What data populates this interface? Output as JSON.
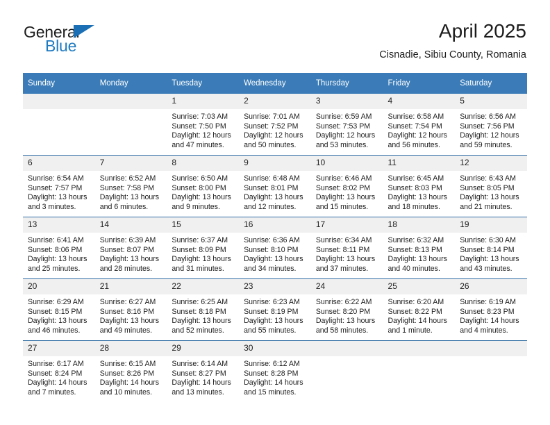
{
  "logo": {
    "word_top": "General",
    "word_bottom": "Blue",
    "accent_color": "#1a6fb5"
  },
  "header": {
    "title": "April 2025",
    "subtitle": "Cisnadie, Sibiu County, Romania"
  },
  "calendar": {
    "header_bg": "#3b7cb8",
    "daynum_bg": "#f0f0f0",
    "row_border": "#2e6ca4",
    "weekday_names": [
      "Sunday",
      "Monday",
      "Tuesday",
      "Wednesday",
      "Thursday",
      "Friday",
      "Saturday"
    ],
    "weeks": [
      [
        {
          "day": ""
        },
        {
          "day": ""
        },
        {
          "day": "1",
          "sunrise": "Sunrise: 7:03 AM",
          "sunset": "Sunset: 7:50 PM",
          "daylight_1": "Daylight: 12 hours",
          "daylight_2": "and 47 minutes."
        },
        {
          "day": "2",
          "sunrise": "Sunrise: 7:01 AM",
          "sunset": "Sunset: 7:52 PM",
          "daylight_1": "Daylight: 12 hours",
          "daylight_2": "and 50 minutes."
        },
        {
          "day": "3",
          "sunrise": "Sunrise: 6:59 AM",
          "sunset": "Sunset: 7:53 PM",
          "daylight_1": "Daylight: 12 hours",
          "daylight_2": "and 53 minutes."
        },
        {
          "day": "4",
          "sunrise": "Sunrise: 6:58 AM",
          "sunset": "Sunset: 7:54 PM",
          "daylight_1": "Daylight: 12 hours",
          "daylight_2": "and 56 minutes."
        },
        {
          "day": "5",
          "sunrise": "Sunrise: 6:56 AM",
          "sunset": "Sunset: 7:56 PM",
          "daylight_1": "Daylight: 12 hours",
          "daylight_2": "and 59 minutes."
        }
      ],
      [
        {
          "day": "6",
          "sunrise": "Sunrise: 6:54 AM",
          "sunset": "Sunset: 7:57 PM",
          "daylight_1": "Daylight: 13 hours",
          "daylight_2": "and 3 minutes."
        },
        {
          "day": "7",
          "sunrise": "Sunrise: 6:52 AM",
          "sunset": "Sunset: 7:58 PM",
          "daylight_1": "Daylight: 13 hours",
          "daylight_2": "and 6 minutes."
        },
        {
          "day": "8",
          "sunrise": "Sunrise: 6:50 AM",
          "sunset": "Sunset: 8:00 PM",
          "daylight_1": "Daylight: 13 hours",
          "daylight_2": "and 9 minutes."
        },
        {
          "day": "9",
          "sunrise": "Sunrise: 6:48 AM",
          "sunset": "Sunset: 8:01 PM",
          "daylight_1": "Daylight: 13 hours",
          "daylight_2": "and 12 minutes."
        },
        {
          "day": "10",
          "sunrise": "Sunrise: 6:46 AM",
          "sunset": "Sunset: 8:02 PM",
          "daylight_1": "Daylight: 13 hours",
          "daylight_2": "and 15 minutes."
        },
        {
          "day": "11",
          "sunrise": "Sunrise: 6:45 AM",
          "sunset": "Sunset: 8:03 PM",
          "daylight_1": "Daylight: 13 hours",
          "daylight_2": "and 18 minutes."
        },
        {
          "day": "12",
          "sunrise": "Sunrise: 6:43 AM",
          "sunset": "Sunset: 8:05 PM",
          "daylight_1": "Daylight: 13 hours",
          "daylight_2": "and 21 minutes."
        }
      ],
      [
        {
          "day": "13",
          "sunrise": "Sunrise: 6:41 AM",
          "sunset": "Sunset: 8:06 PM",
          "daylight_1": "Daylight: 13 hours",
          "daylight_2": "and 25 minutes."
        },
        {
          "day": "14",
          "sunrise": "Sunrise: 6:39 AM",
          "sunset": "Sunset: 8:07 PM",
          "daylight_1": "Daylight: 13 hours",
          "daylight_2": "and 28 minutes."
        },
        {
          "day": "15",
          "sunrise": "Sunrise: 6:37 AM",
          "sunset": "Sunset: 8:09 PM",
          "daylight_1": "Daylight: 13 hours",
          "daylight_2": "and 31 minutes."
        },
        {
          "day": "16",
          "sunrise": "Sunrise: 6:36 AM",
          "sunset": "Sunset: 8:10 PM",
          "daylight_1": "Daylight: 13 hours",
          "daylight_2": "and 34 minutes."
        },
        {
          "day": "17",
          "sunrise": "Sunrise: 6:34 AM",
          "sunset": "Sunset: 8:11 PM",
          "daylight_1": "Daylight: 13 hours",
          "daylight_2": "and 37 minutes."
        },
        {
          "day": "18",
          "sunrise": "Sunrise: 6:32 AM",
          "sunset": "Sunset: 8:13 PM",
          "daylight_1": "Daylight: 13 hours",
          "daylight_2": "and 40 minutes."
        },
        {
          "day": "19",
          "sunrise": "Sunrise: 6:30 AM",
          "sunset": "Sunset: 8:14 PM",
          "daylight_1": "Daylight: 13 hours",
          "daylight_2": "and 43 minutes."
        }
      ],
      [
        {
          "day": "20",
          "sunrise": "Sunrise: 6:29 AM",
          "sunset": "Sunset: 8:15 PM",
          "daylight_1": "Daylight: 13 hours",
          "daylight_2": "and 46 minutes."
        },
        {
          "day": "21",
          "sunrise": "Sunrise: 6:27 AM",
          "sunset": "Sunset: 8:16 PM",
          "daylight_1": "Daylight: 13 hours",
          "daylight_2": "and 49 minutes."
        },
        {
          "day": "22",
          "sunrise": "Sunrise: 6:25 AM",
          "sunset": "Sunset: 8:18 PM",
          "daylight_1": "Daylight: 13 hours",
          "daylight_2": "and 52 minutes."
        },
        {
          "day": "23",
          "sunrise": "Sunrise: 6:23 AM",
          "sunset": "Sunset: 8:19 PM",
          "daylight_1": "Daylight: 13 hours",
          "daylight_2": "and 55 minutes."
        },
        {
          "day": "24",
          "sunrise": "Sunrise: 6:22 AM",
          "sunset": "Sunset: 8:20 PM",
          "daylight_1": "Daylight: 13 hours",
          "daylight_2": "and 58 minutes."
        },
        {
          "day": "25",
          "sunrise": "Sunrise: 6:20 AM",
          "sunset": "Sunset: 8:22 PM",
          "daylight_1": "Daylight: 14 hours",
          "daylight_2": "and 1 minute."
        },
        {
          "day": "26",
          "sunrise": "Sunrise: 6:19 AM",
          "sunset": "Sunset: 8:23 PM",
          "daylight_1": "Daylight: 14 hours",
          "daylight_2": "and 4 minutes."
        }
      ],
      [
        {
          "day": "27",
          "sunrise": "Sunrise: 6:17 AM",
          "sunset": "Sunset: 8:24 PM",
          "daylight_1": "Daylight: 14 hours",
          "daylight_2": "and 7 minutes."
        },
        {
          "day": "28",
          "sunrise": "Sunrise: 6:15 AM",
          "sunset": "Sunset: 8:26 PM",
          "daylight_1": "Daylight: 14 hours",
          "daylight_2": "and 10 minutes."
        },
        {
          "day": "29",
          "sunrise": "Sunrise: 6:14 AM",
          "sunset": "Sunset: 8:27 PM",
          "daylight_1": "Daylight: 14 hours",
          "daylight_2": "and 13 minutes."
        },
        {
          "day": "30",
          "sunrise": "Sunrise: 6:12 AM",
          "sunset": "Sunset: 8:28 PM",
          "daylight_1": "Daylight: 14 hours",
          "daylight_2": "and 15 minutes."
        },
        {
          "day": ""
        },
        {
          "day": ""
        },
        {
          "day": ""
        }
      ]
    ]
  }
}
